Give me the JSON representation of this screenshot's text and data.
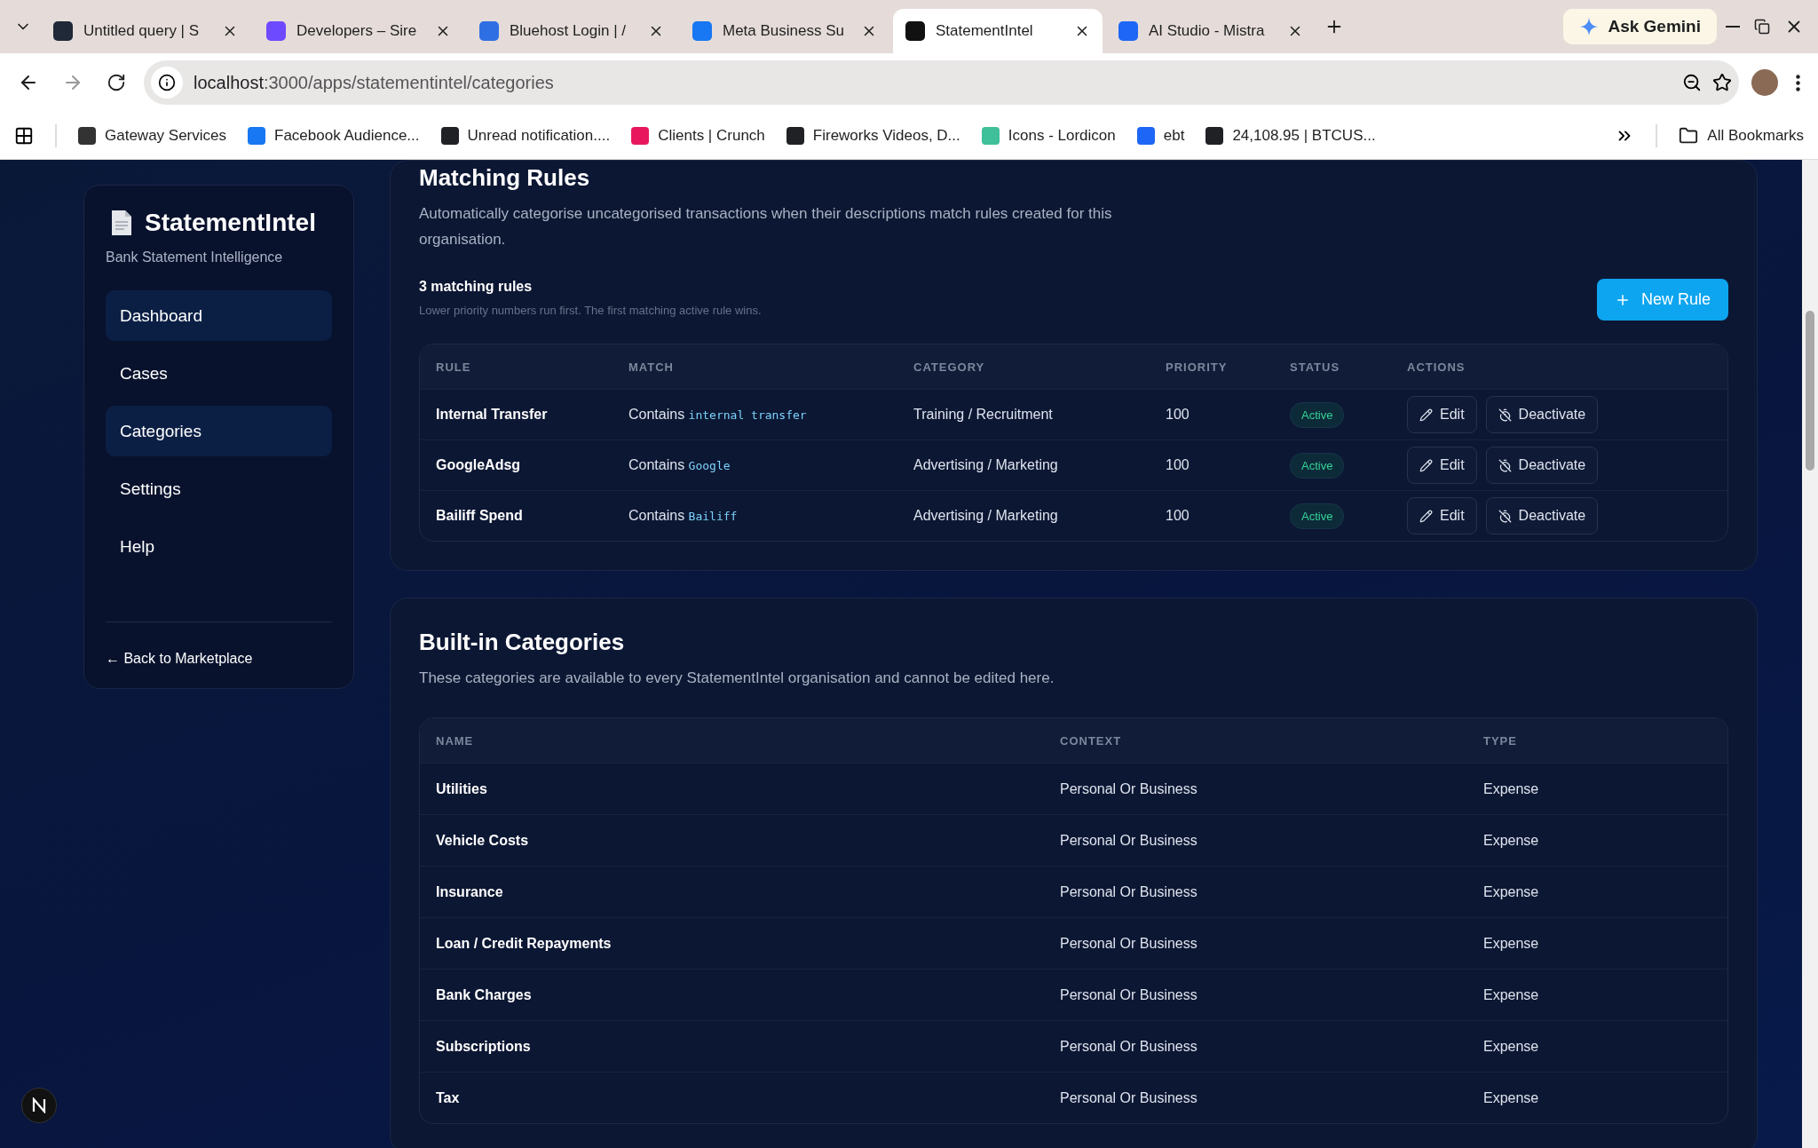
{
  "browser": {
    "tabs": [
      {
        "title": "Untitled query | S",
        "color": "#1f2937",
        "selected": false
      },
      {
        "title": "Developers – Sire",
        "color": "#6d4aff",
        "selected": false
      },
      {
        "title": "Bluehost Login | /",
        "color": "#2f6fe4",
        "selected": false
      },
      {
        "title": "Meta Business Su",
        "color": "#1877f2",
        "selected": false
      },
      {
        "title": "StatementIntel",
        "color": "#111111",
        "selected": true
      },
      {
        "title": "AI Studio - Mistra",
        "color": "#1e66f5",
        "selected": false
      }
    ],
    "ask_gemini": "Ask Gemini",
    "address": {
      "host": "localhost",
      "path": ":3000/apps/statementintel/categories"
    },
    "bookmarks": [
      {
        "title": "Gateway Services",
        "color": "#333333"
      },
      {
        "title": "Facebook Audience...",
        "color": "#1877f2"
      },
      {
        "title": "Unread notification....",
        "color": "#202124"
      },
      {
        "title": "Clients | Crunch",
        "color": "#e8175d"
      },
      {
        "title": "Fireworks Videos, D...",
        "color": "#202124"
      },
      {
        "title": "Icons - Lordicon",
        "color": "#3fbf9a"
      },
      {
        "title": "ebt",
        "color": "#1e66f5"
      },
      {
        "title": "24,108.95 | BTCUS...",
        "color": "#202124"
      }
    ],
    "all_bookmarks": "All Bookmarks"
  },
  "sidebar": {
    "brand": "StatementIntel",
    "subtitle": "Bank Statement Intelligence",
    "nav": [
      {
        "label": "Dashboard",
        "selected": true
      },
      {
        "label": "Cases",
        "selected": false
      },
      {
        "label": "Categories",
        "selected": true
      },
      {
        "label": "Settings",
        "selected": false
      },
      {
        "label": "Help",
        "selected": false
      }
    ],
    "back_link": "← Back to Marketplace"
  },
  "rules": {
    "title": "Matching Rules",
    "description": "Automatically categorise uncategorised transactions when their descriptions match rules created for this organisation.",
    "count": "3 matching rules",
    "hint": "Lower priority numbers run first. The first matching active rule wins.",
    "new_rule": "New Rule",
    "columns": [
      "RULE",
      "MATCH",
      "CATEGORY",
      "PRIORITY",
      "STATUS",
      "ACTIONS"
    ],
    "rows": [
      {
        "rule": "Internal Transfer",
        "match_prefix": "Contains",
        "match_term": "internal transfer",
        "category": "Training / Recruitment",
        "priority": "100",
        "status": "Active",
        "active": true,
        "actions": [
          "Edit",
          "Deactivate"
        ]
      },
      {
        "rule": "GoogleAdsg",
        "match_prefix": "Contains",
        "match_term": "Google",
        "category": "Advertising / Marketing",
        "priority": "100",
        "status": "Active",
        "active": true,
        "actions": [
          "Edit",
          "Deactivate"
        ]
      },
      {
        "rule": "Bailiff Spend",
        "match_prefix": "Contains",
        "match_term": "Bailiff",
        "category": "Advertising / Marketing",
        "priority": "100",
        "status": "Active",
        "active": true,
        "actions": [
          "Edit",
          "Deactivate"
        ]
      }
    ]
  },
  "categories": {
    "title": "Built-in Categories",
    "description": "These categories are available to every StatementIntel organisation and cannot be edited here.",
    "columns": [
      "NAME",
      "CONTEXT",
      "TYPE"
    ],
    "rows": [
      {
        "name": "Utilities",
        "context": "Personal Or Business",
        "type": "Expense"
      },
      {
        "name": "Vehicle Costs",
        "context": "Personal Or Business",
        "type": "Expense"
      },
      {
        "name": "Insurance",
        "context": "Personal Or Business",
        "type": "Expense"
      },
      {
        "name": "Loan / Credit Repayments",
        "context": "Personal Or Business",
        "type": "Expense"
      },
      {
        "name": "Bank Charges",
        "context": "Personal Or Business",
        "type": "Expense"
      },
      {
        "name": "Subscriptions",
        "context": "Personal Or Business",
        "type": "Expense"
      },
      {
        "name": "Tax",
        "context": "Personal Or Business",
        "type": "Expense"
      }
    ]
  }
}
